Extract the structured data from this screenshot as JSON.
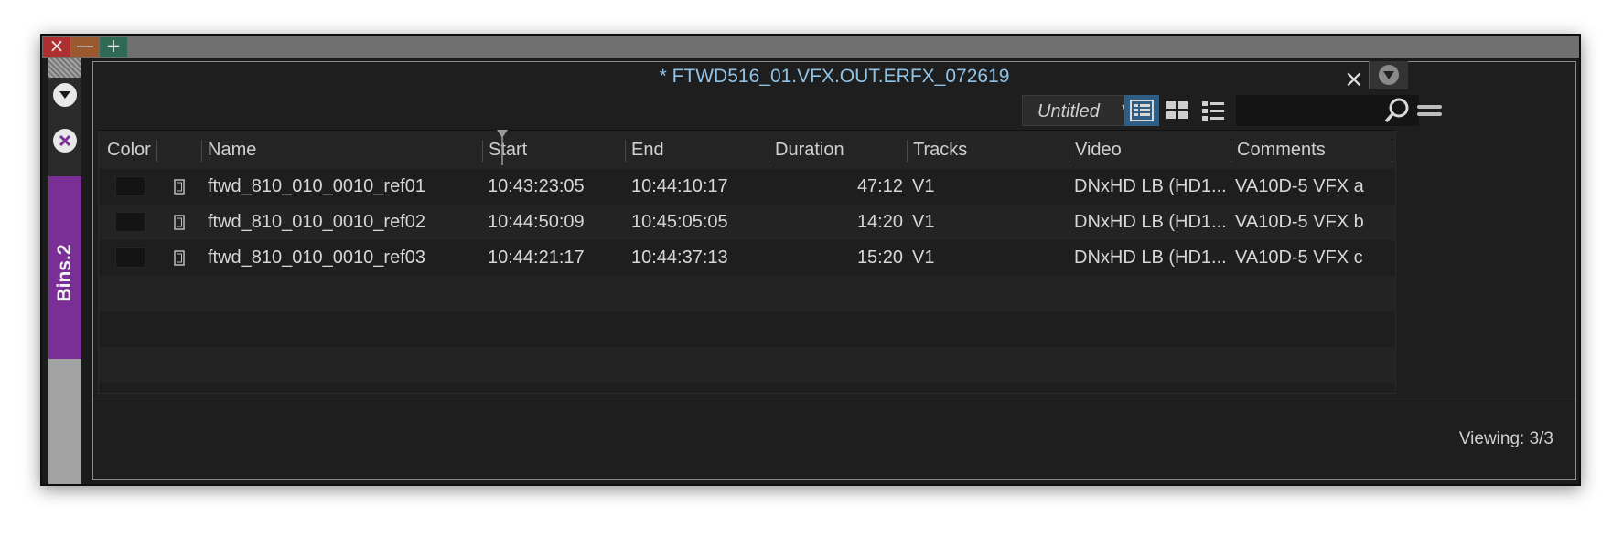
{
  "window": {
    "close_glyph": "×",
    "minimize_glyph": "—",
    "maximize_glyph": "+"
  },
  "sidebar": {
    "tab_label": "Bins.2"
  },
  "bin": {
    "title": "* FTWD516_01.VFX.OUT.ERFX_072619",
    "close_glyph": "×",
    "view_name": "Untitled",
    "columns": [
      "Color",
      "",
      "Name",
      "Start",
      "End",
      "Duration",
      "Tracks",
      "Video",
      "Comments"
    ],
    "rows": [
      {
        "name": "ftwd_810_010_0010_ref01",
        "start": "10:43:23:05",
        "end": "10:44:10:17",
        "duration": "47:12",
        "tracks": "V1",
        "video": "DNxHD LB (HD1...",
        "comments": "VA10D-5 VFX a"
      },
      {
        "name": "ftwd_810_010_0010_ref02",
        "start": "10:44:50:09",
        "end": "10:45:05:05",
        "duration": "14:20",
        "tracks": "V1",
        "video": "DNxHD LB (HD1...",
        "comments": "VA10D-5 VFX b"
      },
      {
        "name": "ftwd_810_010_0010_ref03",
        "start": "10:44:21:17",
        "end": "10:44:37:13",
        "duration": "15:20",
        "tracks": "V1",
        "video": "DNxHD LB (HD1...",
        "comments": "VA10D-5 VFX c"
      }
    ],
    "status": "Viewing: 3/3"
  },
  "colors": {
    "accent_title": "#8fc3e8",
    "bin_tab": "#7a2f96",
    "active_view": "#2f5d84",
    "close_button": "#ad2f2f",
    "minimize_button": "#9b5a2e",
    "maximize_button": "#2f6a55"
  },
  "icons": {
    "close": "close-icon",
    "minimize": "minimize-icon",
    "maximize": "maximize-icon",
    "collapse": "chevron-down-icon",
    "bin_close": "circle-x-icon",
    "view_menu": "triangle-down-icon",
    "list_view": "list-view-icon",
    "frame_view": "grid-view-icon",
    "script_view": "script-view-icon",
    "search": "search-icon",
    "fast_menu": "hamburger-icon",
    "clip": "film-clip-icon"
  }
}
